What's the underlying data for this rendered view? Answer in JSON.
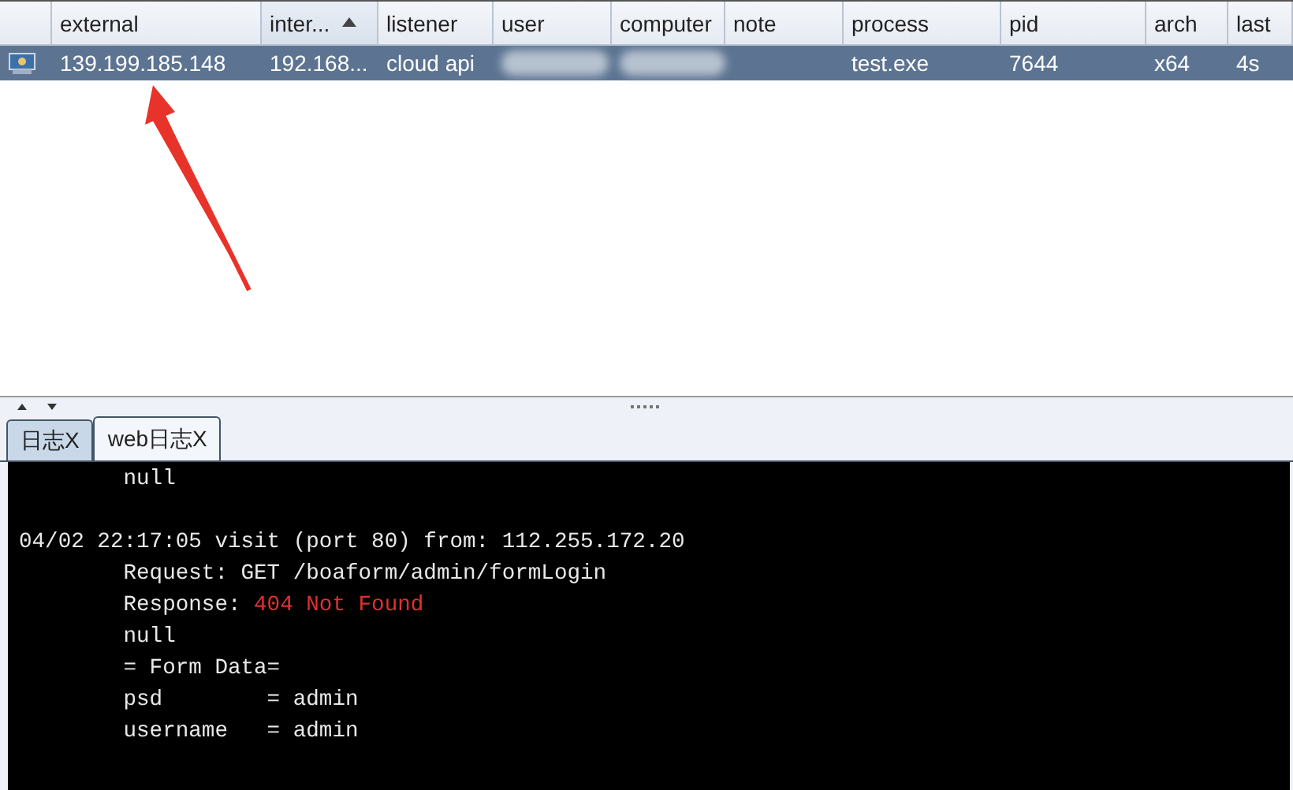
{
  "table": {
    "columns": [
      {
        "kind": "icon"
      },
      {
        "kind": "label",
        "label": "external",
        "sorted": false
      },
      {
        "kind": "label",
        "label": "inter...",
        "sorted": true
      },
      {
        "kind": "label",
        "label": "listener",
        "sorted": false
      },
      {
        "kind": "label",
        "label": "user",
        "sorted": false
      },
      {
        "kind": "label",
        "label": "computer",
        "sorted": false
      },
      {
        "kind": "label",
        "label": "note",
        "sorted": false
      },
      {
        "kind": "label",
        "label": "process",
        "sorted": false
      },
      {
        "kind": "label",
        "label": "pid",
        "sorted": false
      },
      {
        "kind": "label",
        "label": "arch",
        "sorted": false
      },
      {
        "kind": "label",
        "label": "last",
        "sorted": false
      }
    ],
    "rows": [
      {
        "selected": true,
        "cells": [
          {
            "kind": "icon"
          },
          {
            "kind": "text",
            "text": "139.199.185.148"
          },
          {
            "kind": "text",
            "text": "192.168..."
          },
          {
            "kind": "text",
            "text": "cloud api"
          },
          {
            "kind": "redacted"
          },
          {
            "kind": "redacted"
          },
          {
            "kind": "empty"
          },
          {
            "kind": "text",
            "text": "test.exe"
          },
          {
            "kind": "text",
            "text": "7644"
          },
          {
            "kind": "text",
            "text": "x64"
          },
          {
            "kind": "text",
            "text": "4s"
          }
        ]
      }
    ]
  },
  "annotation": {
    "kind": "arrow"
  },
  "tabs": [
    {
      "label": "日志X",
      "selected": false
    },
    {
      "label": "web日志X",
      "selected": true
    }
  ],
  "console": {
    "lines": [
      {
        "kind": "text",
        "segments": [
          {
            "text": "        null",
            "kind": "normal"
          }
        ]
      },
      {
        "kind": "blank"
      },
      {
        "kind": "text",
        "segments": [
          {
            "text": "04/02 22:17:05 visit (port 80) from: 112.255.172.20",
            "kind": "normal"
          }
        ]
      },
      {
        "kind": "text",
        "segments": [
          {
            "text": "        Request: GET /boaform/admin/formLogin",
            "kind": "normal"
          }
        ]
      },
      {
        "kind": "text",
        "segments": [
          {
            "text": "        Response: ",
            "kind": "normal"
          },
          {
            "text": "404 Not Found",
            "kind": "error"
          }
        ]
      },
      {
        "kind": "text",
        "segments": [
          {
            "text": "        null",
            "kind": "normal"
          }
        ]
      },
      {
        "kind": "text",
        "segments": [
          {
            "text": "        = Form Data=",
            "kind": "normal"
          }
        ]
      },
      {
        "kind": "text",
        "segments": [
          {
            "text": "        psd        = admin",
            "kind": "normal"
          }
        ]
      },
      {
        "kind": "text",
        "segments": [
          {
            "text": "        username   = admin",
            "kind": "normal"
          }
        ]
      }
    ]
  }
}
